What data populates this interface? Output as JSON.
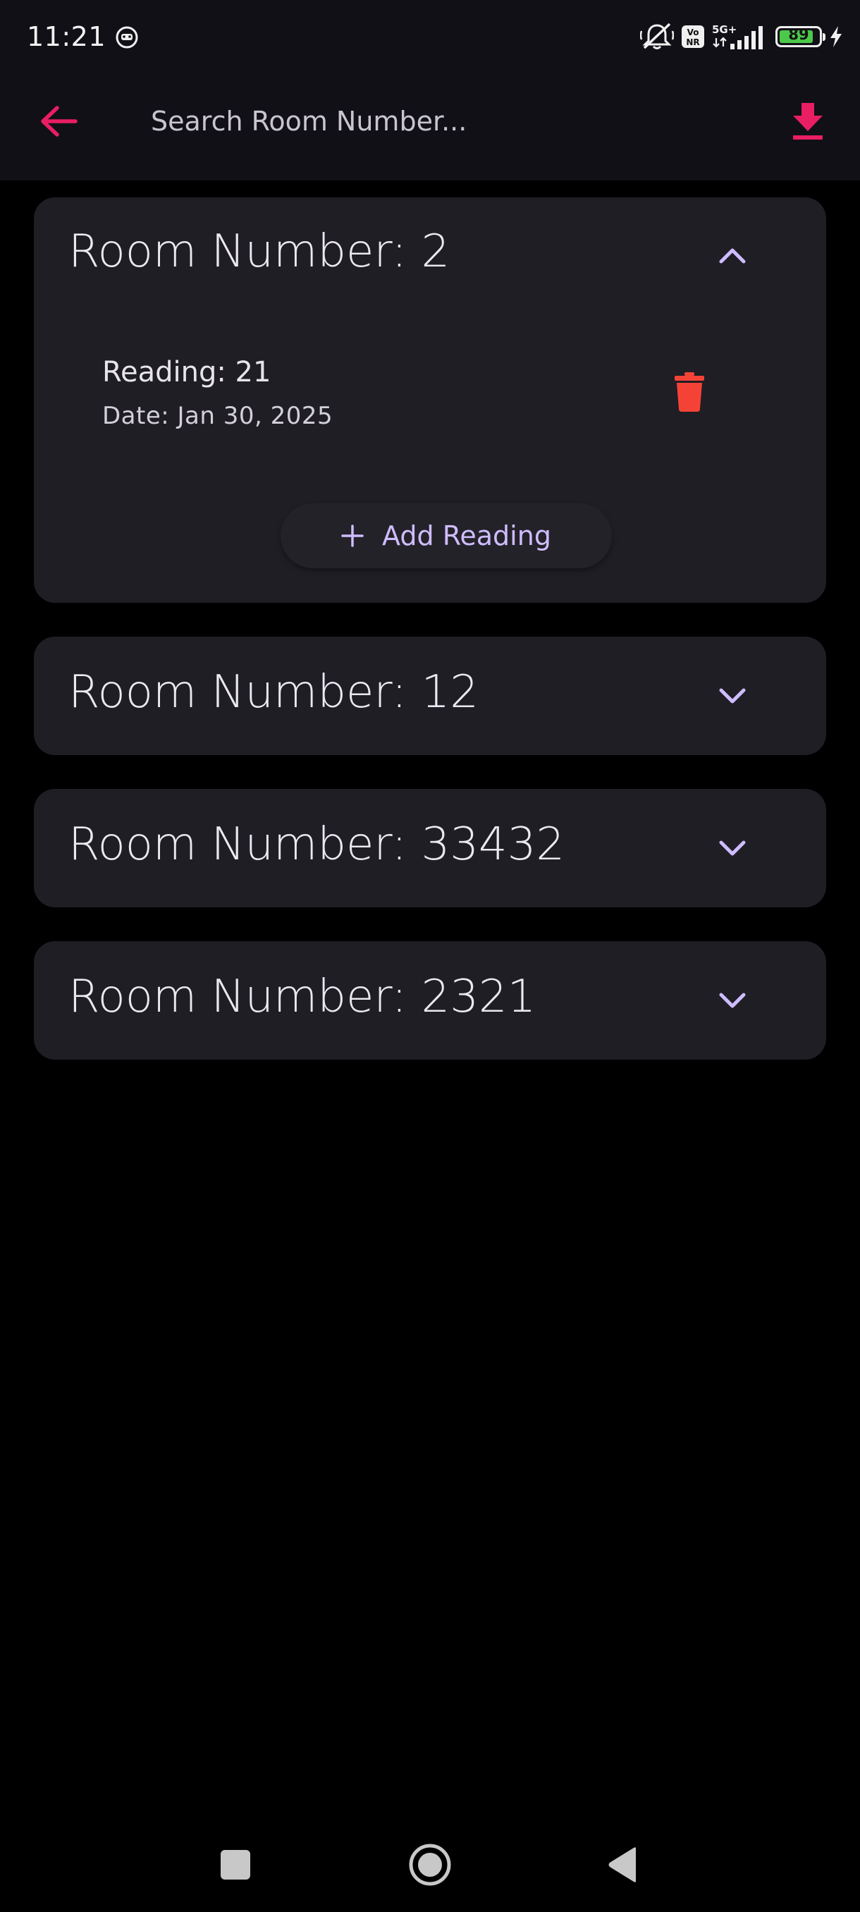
{
  "status_bar": {
    "time": "11:21",
    "battery_percent": "89",
    "network_label": "5G+",
    "volte_label": "Vo NR"
  },
  "app_bar": {
    "search_placeholder": "Search Room Number...",
    "search_value": ""
  },
  "colors": {
    "accent_pink": "#e91e63",
    "chevron_purple": "#cfbcff",
    "delete_red": "#f44336",
    "card_bg": "#1f1e24"
  },
  "rooms": [
    {
      "title": "Room Number: 2",
      "expanded": true,
      "readings": [
        {
          "reading": "Reading: 21",
          "date": "Date: Jan 30, 2025"
        }
      ],
      "add_label": "Add Reading"
    },
    {
      "title": "Room Number: 12",
      "expanded": false
    },
    {
      "title": "Room Number: 33432",
      "expanded": false
    },
    {
      "title": "Room Number: 2321",
      "expanded": false
    }
  ]
}
